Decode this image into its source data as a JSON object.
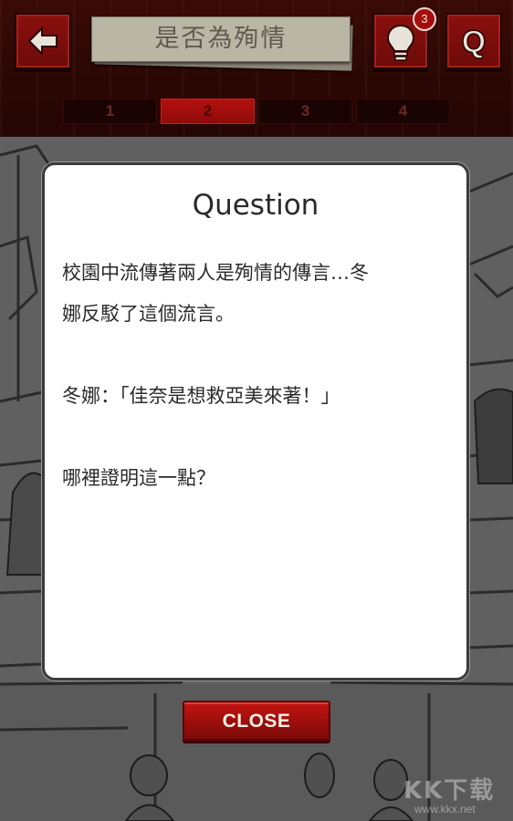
{
  "header": {
    "stage_title": "是否為殉情",
    "hint_count": "3",
    "q_label": "Q",
    "tabs": [
      {
        "label": "1",
        "active": false
      },
      {
        "label": "2",
        "active": true
      },
      {
        "label": "3",
        "active": false
      },
      {
        "label": "4",
        "active": false
      }
    ],
    "icons": {
      "back": "arrow-left-icon",
      "hint": "lightbulb-icon"
    }
  },
  "dialog": {
    "title": "Question",
    "lines": [
      "校園中流傳著兩人是殉情的傳言…冬",
      "娜反駁了這個流言。",
      "冬娜：「佳奈是想救亞美來著！」",
      "哪裡證明這一點？"
    ],
    "close_label": "CLOSE"
  },
  "watermark": {
    "brand": "KK下载",
    "url": "www.kkx.net"
  },
  "colors": {
    "accent_red": "#a40d0b",
    "header_bg": "#2a0704",
    "dialog_bg": "#ffffff"
  }
}
